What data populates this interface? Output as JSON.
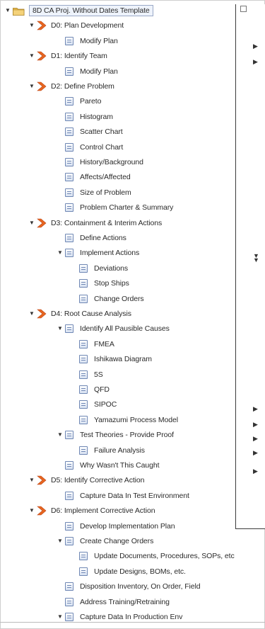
{
  "tree": {
    "items": [
      {
        "label": "8D CA Proj. Without Dates Template",
        "depth": 0,
        "icon": "folder",
        "toggle": "expanded"
      },
      {
        "label": "D0: Plan Development",
        "depth": 1,
        "icon": "chevron",
        "toggle": "expanded"
      },
      {
        "label": "Modify Plan",
        "depth": 2,
        "icon": "doc",
        "toggle": "none"
      },
      {
        "label": "D1: Identify Team",
        "depth": 1,
        "icon": "chevron",
        "toggle": "expanded"
      },
      {
        "label": "Modify Plan",
        "depth": 2,
        "icon": "doc",
        "toggle": "none"
      },
      {
        "label": "D2: Define Problem",
        "depth": 1,
        "icon": "chevron",
        "toggle": "expanded"
      },
      {
        "label": "Pareto",
        "depth": 2,
        "icon": "doc",
        "toggle": "none"
      },
      {
        "label": "Histogram",
        "depth": 2,
        "icon": "doc",
        "toggle": "none"
      },
      {
        "label": "Scatter Chart",
        "depth": 2,
        "icon": "doc",
        "toggle": "none"
      },
      {
        "label": "Control Chart",
        "depth": 2,
        "icon": "doc",
        "toggle": "none"
      },
      {
        "label": "History/Background",
        "depth": 2,
        "icon": "doc",
        "toggle": "none"
      },
      {
        "label": "Affects/Affected",
        "depth": 2,
        "icon": "doc",
        "toggle": "none"
      },
      {
        "label": "Size of Problem",
        "depth": 2,
        "icon": "doc",
        "toggle": "none"
      },
      {
        "label": "Problem Charter & Summary",
        "depth": 2,
        "icon": "doc",
        "toggle": "none"
      },
      {
        "label": "D3: Containment & Interim Actions",
        "depth": 1,
        "icon": "chevron",
        "toggle": "expanded"
      },
      {
        "label": "Define Actions",
        "depth": 2,
        "icon": "doc",
        "toggle": "none"
      },
      {
        "label": "Implement Actions",
        "depth": 2,
        "icon": "doc",
        "toggle": "expanded"
      },
      {
        "label": "Deviations",
        "depth": 3,
        "icon": "doc",
        "toggle": "none"
      },
      {
        "label": "Stop Ships",
        "depth": 3,
        "icon": "doc",
        "toggle": "none"
      },
      {
        "label": "Change Orders",
        "depth": 3,
        "icon": "doc",
        "toggle": "none"
      },
      {
        "label": "D4: Root Cause Analysis",
        "depth": 1,
        "icon": "chevron",
        "toggle": "expanded"
      },
      {
        "label": "Identify All Pausible Causes",
        "depth": 2,
        "icon": "doc",
        "toggle": "expanded"
      },
      {
        "label": "FMEA",
        "depth": 3,
        "icon": "doc",
        "toggle": "none"
      },
      {
        "label": "Ishikawa Diagram",
        "depth": 3,
        "icon": "doc",
        "toggle": "none"
      },
      {
        "label": "5S",
        "depth": 3,
        "icon": "doc",
        "toggle": "none"
      },
      {
        "label": "QFD",
        "depth": 3,
        "icon": "doc",
        "toggle": "none"
      },
      {
        "label": "SIPOC",
        "depth": 3,
        "icon": "doc",
        "toggle": "none"
      },
      {
        "label": "Yamazumi Process Model",
        "depth": 3,
        "icon": "doc",
        "toggle": "none"
      },
      {
        "label": "Test Theories - Provide Proof",
        "depth": 2,
        "icon": "doc",
        "toggle": "expanded"
      },
      {
        "label": "Failure Analysis",
        "depth": 3,
        "icon": "doc",
        "toggle": "none"
      },
      {
        "label": "Why Wasn't This Caught",
        "depth": 2,
        "icon": "doc",
        "toggle": "none"
      },
      {
        "label": "D5: Identify Corrective Action",
        "depth": 1,
        "icon": "chevron",
        "toggle": "expanded"
      },
      {
        "label": "Capture Data In Test Environment",
        "depth": 2,
        "icon": "doc",
        "toggle": "none"
      },
      {
        "label": "D6: Implement Corrective Action",
        "depth": 1,
        "icon": "chevron",
        "toggle": "expanded"
      },
      {
        "label": "Develop Implementation Plan",
        "depth": 2,
        "icon": "doc",
        "toggle": "none"
      },
      {
        "label": "Create Change Orders",
        "depth": 2,
        "icon": "doc",
        "toggle": "expanded"
      },
      {
        "label": "Update Documents, Procedures, SOPs, etc",
        "depth": 3,
        "icon": "doc",
        "toggle": "none"
      },
      {
        "label": "Update Designs, BOMs, etc.",
        "depth": 3,
        "icon": "doc",
        "toggle": "none"
      },
      {
        "label": "Disposition Inventory, On Order, Field",
        "depth": 2,
        "icon": "doc",
        "toggle": "none"
      },
      {
        "label": "Address Training/Retraining",
        "depth": 2,
        "icon": "doc",
        "toggle": "none"
      },
      {
        "label": "Capture Data In Production Env",
        "depth": 2,
        "icon": "doc",
        "toggle": "expanded"
      }
    ]
  },
  "right_panel": {
    "toggles": [
      {
        "glyph": "▼",
        "name": "collapse-toggle"
      },
      {
        "glyph": "▶",
        "name": "expand-toggle"
      },
      {
        "glyph": "▶",
        "name": "expand-toggle"
      },
      {
        "glyph": "▼",
        "name": "collapse-toggle"
      },
      {
        "glyph": "▼",
        "name": "collapse-toggle"
      },
      {
        "glyph": "▶",
        "name": "expand-toggle"
      },
      {
        "glyph": "▶",
        "name": "expand-toggle"
      },
      {
        "glyph": "▶",
        "name": "expand-toggle"
      },
      {
        "glyph": "▶",
        "name": "expand-toggle"
      },
      {
        "glyph": "▶",
        "name": "expand-toggle"
      }
    ]
  },
  "colors": {
    "chevron": "#e8661f",
    "folder": "#e8b84a",
    "doc_border": "#6f87b4"
  }
}
